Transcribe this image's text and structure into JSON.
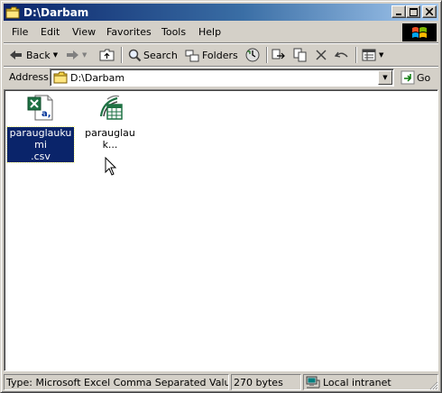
{
  "window": {
    "title": "D:\\Darbam"
  },
  "caption_buttons": {
    "minimize": "_",
    "maximize": "□",
    "close": "✕"
  },
  "menu": {
    "items": [
      "File",
      "Edit",
      "View",
      "Favorites",
      "Tools",
      "Help"
    ]
  },
  "toolbar": {
    "back_label": "Back",
    "search_label": "Search",
    "folders_label": "Folders"
  },
  "address": {
    "label": "Address",
    "value": "D:\\Darbam",
    "go_label": "Go"
  },
  "files": [
    {
      "name": "parauglaukumi.csv",
      "name_line1": "parauglaukumi",
      "name_line2": ".csv",
      "icon": "excel-csv-icon",
      "selected": true
    },
    {
      "name": "parauglauk...",
      "icon": "web-query-icon",
      "selected": false
    }
  ],
  "status": {
    "type_text": "Type: Microsoft Excel Comma Separated Values File",
    "size_text": "270 bytes",
    "zone_text": "Local intranet"
  },
  "colors": {
    "title_active": "#0a246a",
    "title_gradient_end": "#a6caf0",
    "selection": "#0a246a",
    "face": "#d4d0c8"
  }
}
